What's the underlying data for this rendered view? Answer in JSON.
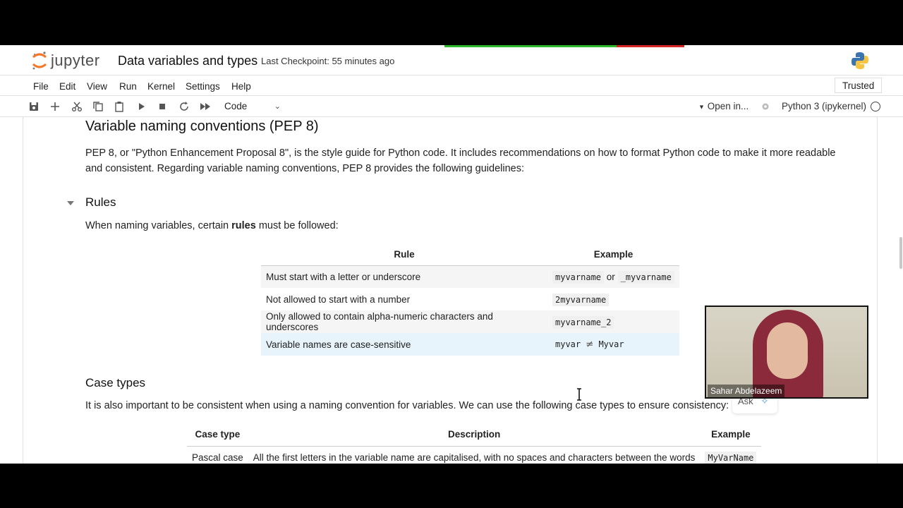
{
  "header": {
    "logo_text": "jupyter",
    "notebook_title": "Data variables and types",
    "checkpoint": "Last Checkpoint: 55 minutes ago"
  },
  "menu": {
    "items": [
      "File",
      "Edit",
      "View",
      "Run",
      "Kernel",
      "Settings",
      "Help"
    ],
    "trusted": "Trusted"
  },
  "toolbar": {
    "icons": [
      "save-icon",
      "add-cell-icon",
      "cut-icon",
      "copy-icon",
      "paste-icon",
      "run-icon",
      "stop-icon",
      "restart-icon",
      "fast-forward-icon"
    ],
    "cell_type": "Code",
    "open_in": "Open in...",
    "kernel": "Python 3 (ipykernel)"
  },
  "notebook": {
    "section_title": "Variable naming conventions (PEP 8)",
    "intro": "PEP 8, or \"Python Enhancement Proposal 8\", is the style guide for Python code. It includes recommendations on how to format Python code to make it more readable and consistent. Regarding variable naming conventions, PEP 8 provides the following guidelines:",
    "rules": {
      "heading": "Rules",
      "text_before": "When naming variables, certain ",
      "text_bold": "rules",
      "text_after": " must be followed:",
      "table": {
        "headers": [
          "Rule",
          "Example"
        ],
        "rows": [
          {
            "rule": "Must start with a letter or underscore",
            "ex1": "myvarname",
            "sep": "or",
            "ex2": "_myvarname"
          },
          {
            "rule": "Not allowed to start with a number",
            "ex1": "2myvarname"
          },
          {
            "rule": "Only allowed to contain alpha-numeric characters and underscores",
            "ex1": "myvarname_2"
          },
          {
            "rule": "Variable names are case-sensitive",
            "ex1": "myvar",
            "sep": "≠",
            "ex2": "Myvar"
          }
        ]
      }
    },
    "case_types": {
      "heading": "Case types",
      "text": "It is also important to be consistent when using a naming convention for variables. We can use the following case types to ensure consistency:",
      "table": {
        "headers": [
          "Case type",
          "Description",
          "Example"
        ],
        "rows": [
          {
            "type": "Pascal case",
            "desc": "All the first letters in the variable name are capitalised, with no spaces and characters between the words",
            "ex": "MyVarName"
          }
        ]
      }
    }
  },
  "overlay": {
    "ask_label": "Ask",
    "webcam_name": "Sahar Abdelazeem"
  },
  "colors": {
    "progress_green": "#2eb82e",
    "progress_red": "#d62728",
    "highlight_row": "#e7f4fb"
  }
}
